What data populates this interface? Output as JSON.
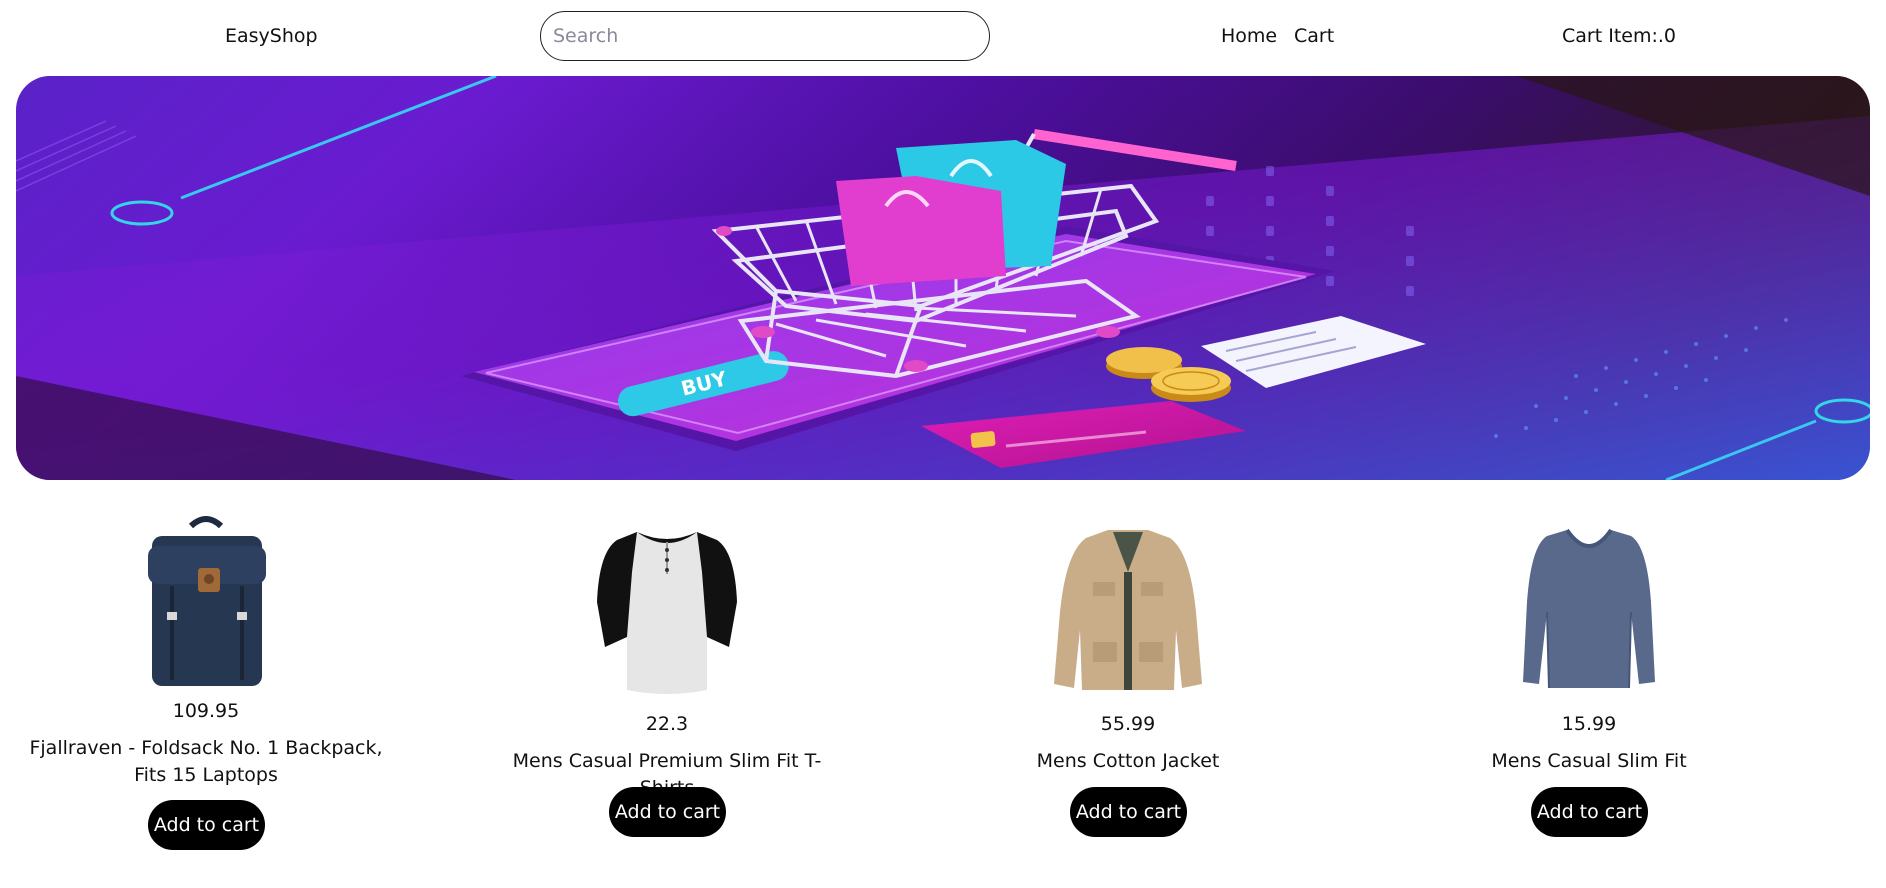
{
  "header": {
    "brand": "EasyShop",
    "search_placeholder": "Search",
    "search_value": "",
    "nav": [
      "Home",
      "Cart"
    ],
    "cart_count_label": "Cart Item:.0"
  },
  "hero": {
    "button_text": "BUY"
  },
  "products": [
    {
      "price": "109.95",
      "title": "Fjallraven - Foldsack No. 1 Backpack, Fits 15 Laptops",
      "button": "Add to cart",
      "icon": "backpack-icon"
    },
    {
      "price": "22.3",
      "title": "Mens Casual Premium Slim Fit T-Shirts",
      "button": "Add to cart",
      "icon": "tshirt-icon"
    },
    {
      "price": "55.99",
      "title": "Mens Cotton Jacket",
      "button": "Add to cart",
      "icon": "jacket-icon"
    },
    {
      "price": "15.99",
      "title": "Mens Casual Slim Fit",
      "button": "Add to cart",
      "icon": "longsleeve-icon"
    }
  ]
}
